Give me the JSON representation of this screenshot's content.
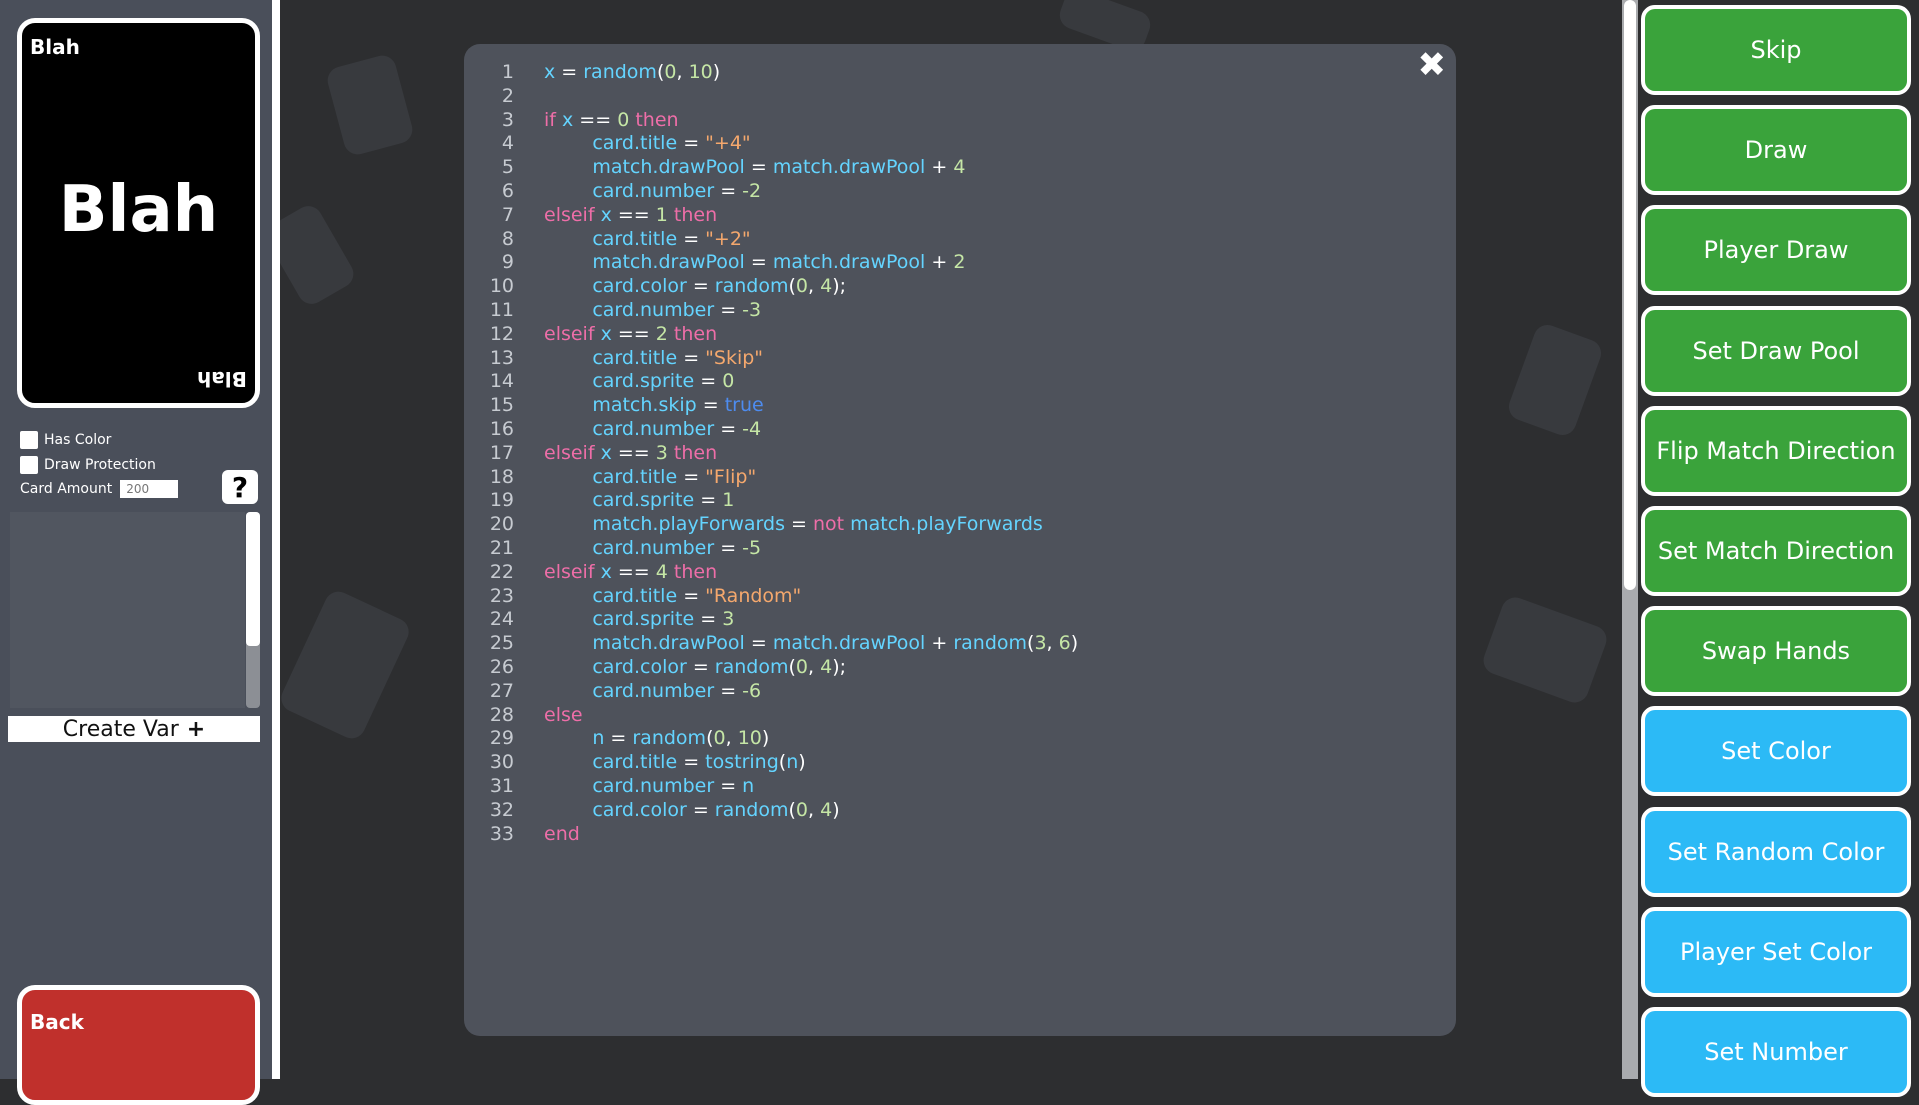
{
  "card": {
    "corner_title": "Blah",
    "center_title": "Blah"
  },
  "options": {
    "has_color_label": "Has Color",
    "draw_protection_label": "Draw Protection",
    "card_amount_label": "Card Amount",
    "card_amount_value": "200",
    "help_label": "?"
  },
  "create_var_label": "Create Var",
  "create_var_icon": "+",
  "back_label": "Back",
  "close_icon": "✖",
  "code_lines": [
    [
      [
        "x",
        "var"
      ],
      [
        " = ",
        "op"
      ],
      [
        "random",
        "var"
      ],
      [
        "(",
        "op"
      ],
      [
        "0",
        "num"
      ],
      [
        ", ",
        "op"
      ],
      [
        "10",
        "num"
      ],
      [
        ")",
        "op"
      ]
    ],
    [],
    [
      [
        "if ",
        "kw"
      ],
      [
        "x",
        "var"
      ],
      [
        " == ",
        "op"
      ],
      [
        "0",
        "num"
      ],
      [
        " then",
        "kw"
      ]
    ],
    [
      [
        "        ",
        "op"
      ],
      [
        "card.title",
        "var"
      ],
      [
        " = ",
        "op"
      ],
      [
        "\"+4\"",
        "str"
      ]
    ],
    [
      [
        "        ",
        "op"
      ],
      [
        "match.drawPool",
        "var"
      ],
      [
        " = ",
        "op"
      ],
      [
        "match.drawPool",
        "var"
      ],
      [
        " + ",
        "op"
      ],
      [
        "4",
        "num"
      ]
    ],
    [
      [
        "        ",
        "op"
      ],
      [
        "card.number",
        "var"
      ],
      [
        " = ",
        "op"
      ],
      [
        "-2",
        "num"
      ]
    ],
    [
      [
        "elseif ",
        "kw"
      ],
      [
        "x",
        "var"
      ],
      [
        " == ",
        "op"
      ],
      [
        "1",
        "num"
      ],
      [
        " then",
        "kw"
      ]
    ],
    [
      [
        "        ",
        "op"
      ],
      [
        "card.title",
        "var"
      ],
      [
        " = ",
        "op"
      ],
      [
        "\"+2\"",
        "str"
      ]
    ],
    [
      [
        "        ",
        "op"
      ],
      [
        "match.drawPool",
        "var"
      ],
      [
        " = ",
        "op"
      ],
      [
        "match.drawPool",
        "var"
      ],
      [
        " + ",
        "op"
      ],
      [
        "2",
        "num"
      ]
    ],
    [
      [
        "        ",
        "op"
      ],
      [
        "card.color",
        "var"
      ],
      [
        " = ",
        "op"
      ],
      [
        "random",
        "var"
      ],
      [
        "(",
        "op"
      ],
      [
        "0",
        "num"
      ],
      [
        ", ",
        "op"
      ],
      [
        "4",
        "num"
      ],
      [
        ");",
        "op"
      ]
    ],
    [
      [
        "        ",
        "op"
      ],
      [
        "card.number",
        "var"
      ],
      [
        " = ",
        "op"
      ],
      [
        "-3",
        "num"
      ]
    ],
    [
      [
        "elseif ",
        "kw"
      ],
      [
        "x",
        "var"
      ],
      [
        " == ",
        "op"
      ],
      [
        "2",
        "num"
      ],
      [
        " then",
        "kw"
      ]
    ],
    [
      [
        "        ",
        "op"
      ],
      [
        "card.title",
        "var"
      ],
      [
        " = ",
        "op"
      ],
      [
        "\"Skip\"",
        "str"
      ]
    ],
    [
      [
        "        ",
        "op"
      ],
      [
        "card.sprite",
        "var"
      ],
      [
        " = ",
        "op"
      ],
      [
        "0",
        "num"
      ]
    ],
    [
      [
        "        ",
        "op"
      ],
      [
        "match.skip",
        "var"
      ],
      [
        " = ",
        "op"
      ],
      [
        "true",
        "bool"
      ]
    ],
    [
      [
        "        ",
        "op"
      ],
      [
        "card.number",
        "var"
      ],
      [
        " = ",
        "op"
      ],
      [
        "-4",
        "num"
      ]
    ],
    [
      [
        "elseif ",
        "kw"
      ],
      [
        "x",
        "var"
      ],
      [
        " == ",
        "op"
      ],
      [
        "3",
        "num"
      ],
      [
        " then",
        "kw"
      ]
    ],
    [
      [
        "        ",
        "op"
      ],
      [
        "card.title",
        "var"
      ],
      [
        " = ",
        "op"
      ],
      [
        "\"Flip\"",
        "str"
      ]
    ],
    [
      [
        "        ",
        "op"
      ],
      [
        "card.sprite",
        "var"
      ],
      [
        " = ",
        "op"
      ],
      [
        "1",
        "num"
      ]
    ],
    [
      [
        "        ",
        "op"
      ],
      [
        "match.playForwards",
        "var"
      ],
      [
        " = ",
        "op"
      ],
      [
        "not ",
        "kw"
      ],
      [
        "match.playForwards",
        "var"
      ]
    ],
    [
      [
        "        ",
        "op"
      ],
      [
        "card.number",
        "var"
      ],
      [
        " = ",
        "op"
      ],
      [
        "-5",
        "num"
      ]
    ],
    [
      [
        "elseif ",
        "kw"
      ],
      [
        "x",
        "var"
      ],
      [
        " == ",
        "op"
      ],
      [
        "4",
        "num"
      ],
      [
        " then",
        "kw"
      ]
    ],
    [
      [
        "        ",
        "op"
      ],
      [
        "card.title",
        "var"
      ],
      [
        " = ",
        "op"
      ],
      [
        "\"Random\"",
        "str"
      ]
    ],
    [
      [
        "        ",
        "op"
      ],
      [
        "card.sprite",
        "var"
      ],
      [
        " = ",
        "op"
      ],
      [
        "3",
        "num"
      ]
    ],
    [
      [
        "        ",
        "op"
      ],
      [
        "match.drawPool",
        "var"
      ],
      [
        " = ",
        "op"
      ],
      [
        "match.drawPool",
        "var"
      ],
      [
        " + ",
        "op"
      ],
      [
        "random",
        "var"
      ],
      [
        "(",
        "op"
      ],
      [
        "3",
        "num"
      ],
      [
        ", ",
        "op"
      ],
      [
        "6",
        "num"
      ],
      [
        ")",
        "op"
      ]
    ],
    [
      [
        "        ",
        "op"
      ],
      [
        "card.color",
        "var"
      ],
      [
        " = ",
        "op"
      ],
      [
        "random",
        "var"
      ],
      [
        "(",
        "op"
      ],
      [
        "0",
        "num"
      ],
      [
        ", ",
        "op"
      ],
      [
        "4",
        "num"
      ],
      [
        ");",
        "op"
      ]
    ],
    [
      [
        "        ",
        "op"
      ],
      [
        "card.number",
        "var"
      ],
      [
        " = ",
        "op"
      ],
      [
        "-6",
        "num"
      ]
    ],
    [
      [
        "else",
        "kw"
      ]
    ],
    [
      [
        "        ",
        "op"
      ],
      [
        "n",
        "var"
      ],
      [
        " = ",
        "op"
      ],
      [
        "random",
        "var"
      ],
      [
        "(",
        "op"
      ],
      [
        "0",
        "num"
      ],
      [
        ", ",
        "op"
      ],
      [
        "10",
        "num"
      ],
      [
        ")",
        "op"
      ]
    ],
    [
      [
        "        ",
        "op"
      ],
      [
        "card.title",
        "var"
      ],
      [
        " = ",
        "op"
      ],
      [
        "tostring",
        "var"
      ],
      [
        "(",
        "op"
      ],
      [
        "n",
        "var"
      ],
      [
        ")",
        "op"
      ]
    ],
    [
      [
        "        ",
        "op"
      ],
      [
        "card.number",
        "var"
      ],
      [
        " = ",
        "op"
      ],
      [
        "n",
        "var"
      ]
    ],
    [
      [
        "        ",
        "op"
      ],
      [
        "card.color",
        "var"
      ],
      [
        " = ",
        "op"
      ],
      [
        "random",
        "var"
      ],
      [
        "(",
        "op"
      ],
      [
        "0",
        "num"
      ],
      [
        ", ",
        "op"
      ],
      [
        "4",
        "num"
      ],
      [
        ")",
        "op"
      ]
    ],
    [
      [
        "end",
        "kw"
      ]
    ]
  ],
  "actions": [
    {
      "label": "Skip",
      "color": "green"
    },
    {
      "label": "Draw",
      "color": "green"
    },
    {
      "label": "Player Draw",
      "color": "green"
    },
    {
      "label": "Set Draw Pool",
      "color": "green"
    },
    {
      "label": "Flip Match Direction",
      "color": "green"
    },
    {
      "label": "Set Match Direction",
      "color": "green"
    },
    {
      "label": "Swap Hands",
      "color": "green"
    },
    {
      "label": "Set Color",
      "color": "blue"
    },
    {
      "label": "Set Random Color",
      "color": "blue"
    },
    {
      "label": "Player Set Color",
      "color": "blue"
    },
    {
      "label": "Set Number",
      "color": "blue"
    }
  ]
}
